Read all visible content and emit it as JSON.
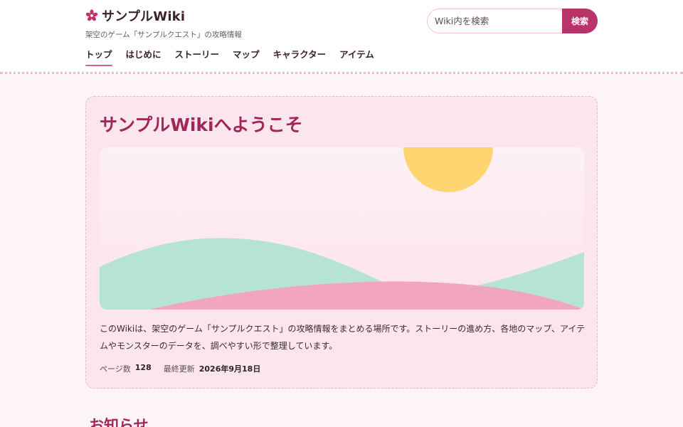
{
  "site": {
    "logo_icon": "sakura-flower-icon",
    "title": "サンプルWiki",
    "subtitle": "架空のゲーム「サンプルクエスト」の攻略情報"
  },
  "search": {
    "placeholder": "Wiki内を検索",
    "button_label": "検索"
  },
  "nav": {
    "items": [
      {
        "label": "トップ",
        "active": true
      },
      {
        "label": "はじめに"
      },
      {
        "label": "ストーリー"
      },
      {
        "label": "マップ"
      },
      {
        "label": "キャラクター"
      },
      {
        "label": "アイテム"
      }
    ]
  },
  "welcome": {
    "title": "サンプルWikiへようこそ",
    "intro": "このWikiは、架空のゲーム「サンプルクエスト」の攻略情報をまとめる場所です。ストーリーの進め方、各地のマップ、アイテムやモンスターのデータを、調べやすい形で整理しています。",
    "page_count_label": "ページ数",
    "page_count": "128",
    "updated_label": "最終更新",
    "updated": "2026年9月18日"
  },
  "news": {
    "title": "お知らせ"
  },
  "colors": {
    "accent": "#b8336a",
    "title_text": "#a3265a",
    "card_bg": "#fce6ee",
    "sun": "#ffd572",
    "hill_green": "#b6e3d4",
    "hill_pink": "#f2a5be"
  }
}
